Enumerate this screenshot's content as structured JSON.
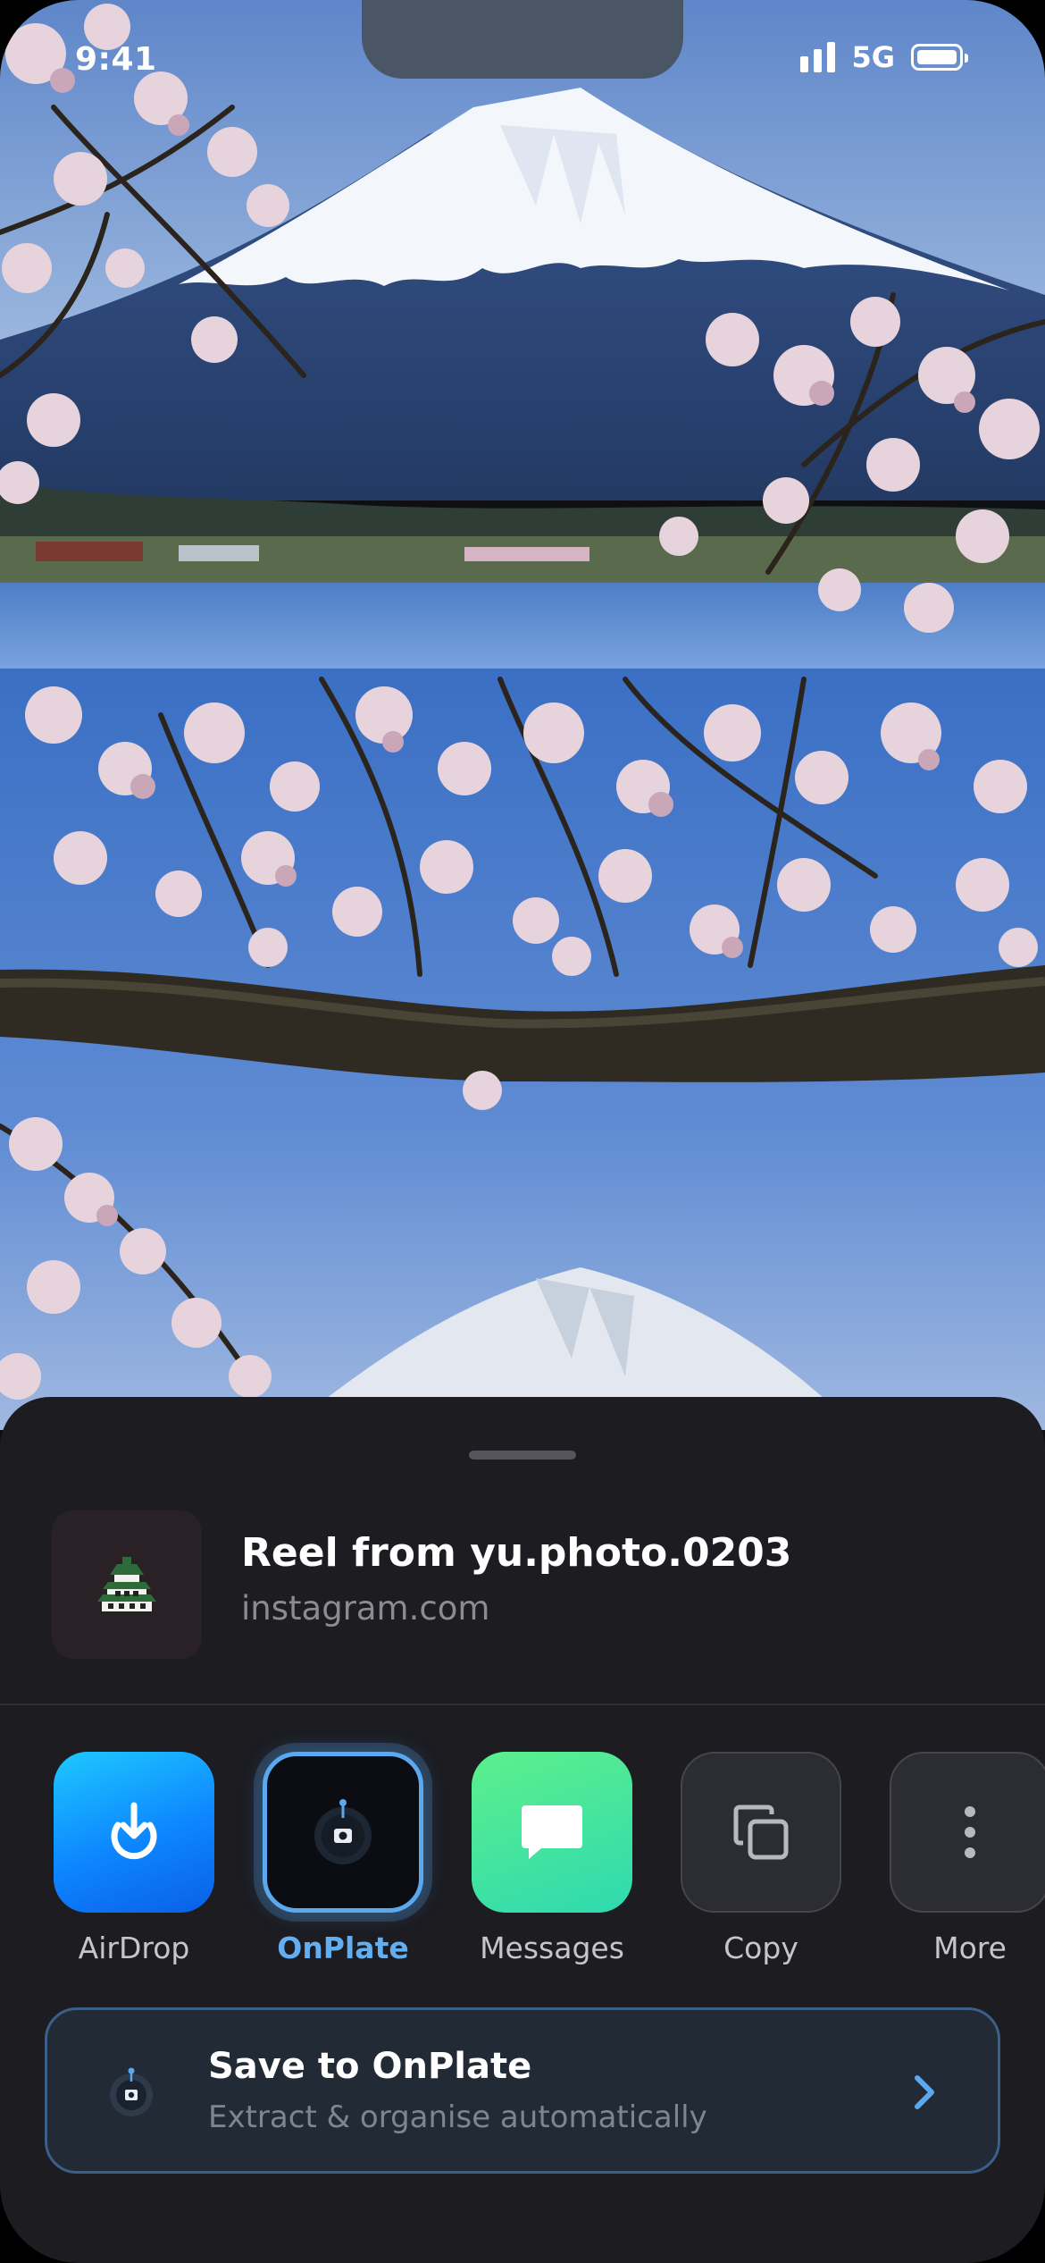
{
  "status_bar": {
    "time": "9:41",
    "network": "5G"
  },
  "share_sheet": {
    "title": "Reel from yu.photo.0203",
    "subtitle": "instagram.com",
    "thumbnail_icon": "castle-icon",
    "apps": [
      {
        "label": "AirDrop",
        "icon": "airdrop-icon",
        "color": "#0d86ff"
      },
      {
        "label": "OnPlate",
        "icon": "onplate-icon",
        "color": "#5aa8ee",
        "selected": true
      },
      {
        "label": "Messages",
        "icon": "message-bubble-icon",
        "color": "#3be39c"
      },
      {
        "label": "Copy",
        "icon": "copy-icon"
      },
      {
        "label": "More",
        "icon": "more-dots-icon"
      }
    ],
    "action": {
      "title": "Save to OnPlate",
      "subtitle": "Extract & organise automatically",
      "accent": "#5aa8ee"
    }
  }
}
